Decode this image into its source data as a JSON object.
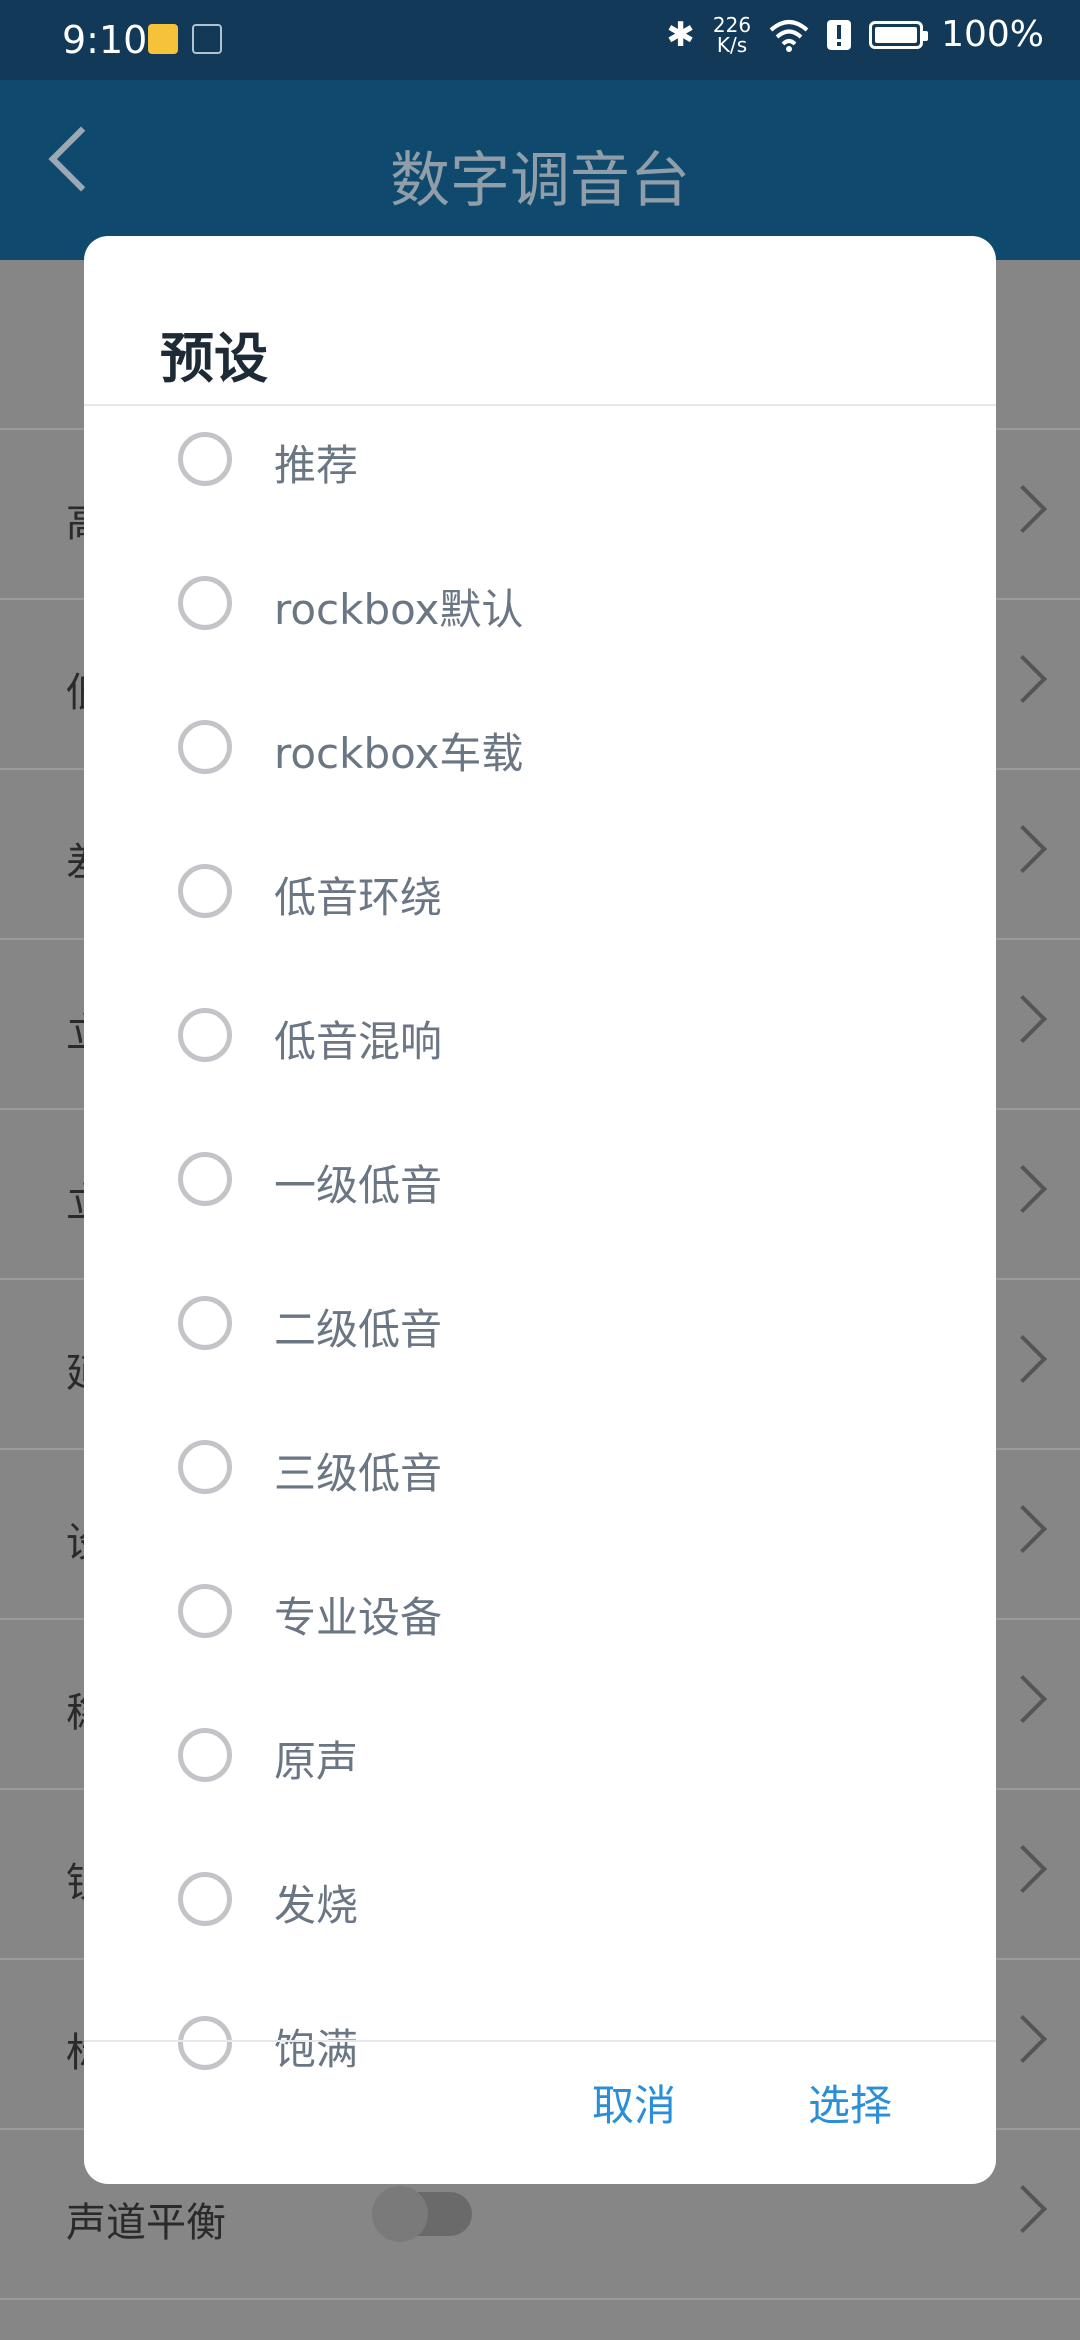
{
  "status_bar": {
    "time": "9:10",
    "net_speed_top": "226",
    "net_speed_bottom": "K/s",
    "battery": "100%"
  },
  "app_bar": {
    "title": "数字调音台"
  },
  "background_rows": [
    {
      "label": "高"
    },
    {
      "label": "低"
    },
    {
      "label": "差"
    },
    {
      "label": "立"
    },
    {
      "label": "立"
    },
    {
      "label": "延"
    },
    {
      "label": "设"
    },
    {
      "label": "稳"
    },
    {
      "label": "锁"
    },
    {
      "label": "标"
    },
    {
      "label": "声道平衡"
    }
  ],
  "dialog": {
    "title": "预设",
    "options": [
      "推荐",
      "rockbox默认",
      "rockbox车载",
      "低音环绕",
      "低音混响",
      "一级低音",
      "二级低音",
      "三级低音",
      "专业设备",
      "原声",
      "发烧",
      "饱满"
    ],
    "cancel_label": "取消",
    "select_label": "选择"
  }
}
